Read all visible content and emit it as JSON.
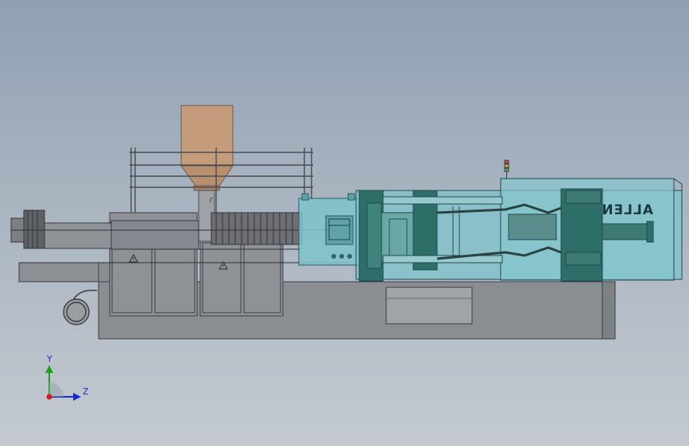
{
  "view": {
    "triad": {
      "y_label": "Y",
      "z_label": "Z"
    }
  },
  "machine": {
    "brand_label": "ALLEN",
    "brand_mirrored": true
  },
  "colors": {
    "background_top": "#8fa0b2",
    "background_bottom": "#c4c9d0",
    "hopper": "#c49c7c",
    "clamp_glass": "#7fc3cb",
    "platen_dark": "#2d6f68",
    "base_gray": "#8a8d92",
    "triad_y": "#1aa51a",
    "triad_z": "#1a2cc8",
    "triad_origin": "#e01818"
  }
}
